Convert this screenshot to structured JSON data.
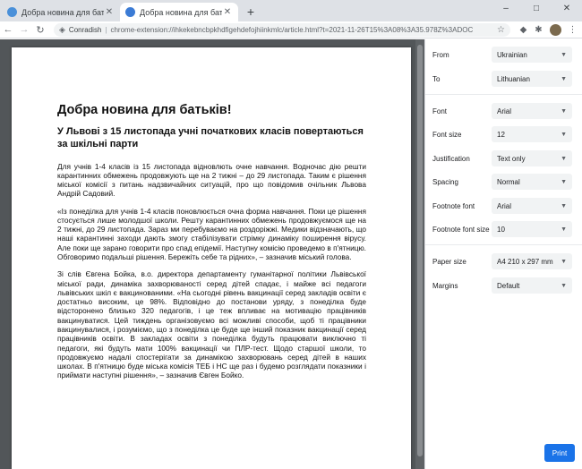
{
  "browser": {
    "tabs": [
      {
        "title": "Добра новина для батьків! - Львів"
      },
      {
        "title": "Добра новина для батьків! - Львів"
      }
    ],
    "new_tab_symbol": "+",
    "window_buttons": {
      "minimize": "–",
      "maximize": "□",
      "close": "✕"
    },
    "address": {
      "origin": "Conradish",
      "separator": "|",
      "url": "chrome-extension://ihkekebncbpkhdfigehdefojhiinkmlc/article.html?t=2021-11-26T15%3A08%3A35.978Z%3ADOC"
    }
  },
  "document": {
    "title": "Добра новина для батьків!",
    "subtitle": "У Львові з 15 листопада учні початкових класів повертаються за шкільні парти",
    "paragraphs": [
      "Для учнів 1-4 класів із 15 листопада відновлють очне навчання. Водночас дію решти карантинних обмежень продовжують ще на 2 тижні – до 29 листопада. Таким є рішення міської комісії з питань надзвичайних ситуацій, про що повідомив очільник Львова Андрій Садовий.",
      "«Із понеділка для учнів 1-4 класів поновлюється очна форма навчання. Поки це рішення стосується лише молодшої школи. Решту карантинних обмежень продовжуємося ще на 2 тижні, до 29 листопада. Зараз ми перебуваємо на роздоріжжі. Медики відзначають, що наші карантинні заходи дають змогу стабілізувати стрімку динаміку поширення вірусу. Але поки ще зарано говорити про спад епідемії. Наступну комісію проведемо в п'ятницю. Обговоримо подальші рішення. Бережіть себе та рідних», – зазначив міський голова.",
      "Зі слів Євгена Бойка, в.о. директора департаменту гуманітарної політики Львівської міської ради, динаміка захворюваності серед дітей спадає, і майже всі педагоги львівських шкіл є вакцинованими. «На сьогодні рівень вакцинації серед закладів освіти є достатньо високим, це 98%. Відповідно до постанови уряду, з понеділка буде відсторонено близько 320 педагогів, і це теж впливає на мотивацію працівників вакцинуватися. Цей тиждень організовуємо всі можливі способи, щоб ті працівники вакцинувалися, і розуміємо, що з понеділка це буде ще інший показник вакцинації серед працівників освіти. В закладах освіти з понеділка будуть працювати виключно ті педагоги, які будуть мати 100% вакцинації чи ПЛР-тест. Щодо старшої школи, то продовжуємо надалі спостерігати за динамікою захворювань серед дітей в наших школах. В п'ятницю буде міська комісія ТЕБ і НС ще раз і будемо розглядати показники і приймати наступні рішення», – зазначив Євген Бойко."
    ]
  },
  "settings": {
    "rows": [
      {
        "label": "From",
        "value": "Ukrainian"
      },
      {
        "label": "To",
        "value": "Lithuanian"
      },
      {
        "label": "Font",
        "value": "Arial"
      },
      {
        "label": "Font size",
        "value": "12"
      },
      {
        "label": "Justification",
        "value": "Text only"
      },
      {
        "label": "Spacing",
        "value": "Normal"
      },
      {
        "label": "Footnote font",
        "value": "Arial"
      },
      {
        "label": "Footnote font size",
        "value": "10"
      },
      {
        "label": "Paper size",
        "value": "A4 210 x 297 mm"
      },
      {
        "label": "Margins",
        "value": "Default"
      }
    ],
    "print_label": "Print"
  }
}
